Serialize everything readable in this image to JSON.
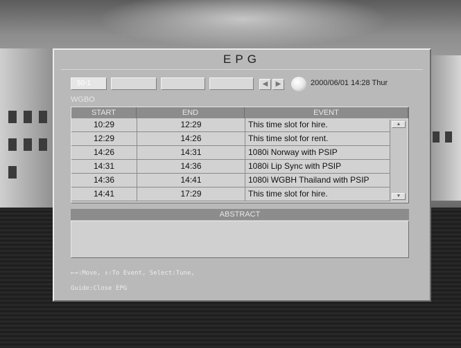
{
  "window": {
    "title": "EPG"
  },
  "toolbar": {
    "channels": [
      "50-1",
      "",
      "",
      ""
    ],
    "datetime": "2000/06/01 14:28 Thur"
  },
  "channel_name": "WGBO",
  "table": {
    "headers": {
      "start": "START",
      "end": "END",
      "event": "EVENT"
    },
    "rows": [
      {
        "start": "10:29",
        "end": "12:29",
        "event": "This time slot for hire."
      },
      {
        "start": "12:29",
        "end": "14:26",
        "event": "This time slot for rent."
      },
      {
        "start": "14:26",
        "end": "14:31",
        "event": "1080i Norway with PSIP"
      },
      {
        "start": "14:31",
        "end": "14:36",
        "event": "1080i Lip Sync with PSIP"
      },
      {
        "start": "14:36",
        "end": "14:41",
        "event": "1080i WGBH Thailand with PSIP"
      },
      {
        "start": "14:41",
        "end": "17:29",
        "event": "This time slot for hire."
      }
    ]
  },
  "abstract": {
    "heading": "ABSTRACT",
    "text": ""
  },
  "help": {
    "line1": "←→:Move,  ⇕:To Event,  Select:Tune,",
    "line2": "Guide:Close EPG"
  },
  "icons": {
    "nav_left": "arrow-left-icon",
    "nav_right": "arrow-right-icon",
    "round_button": "circle-button-icon",
    "scroll_up": "scroll-up-icon",
    "scroll_down": "scroll-down-icon"
  }
}
